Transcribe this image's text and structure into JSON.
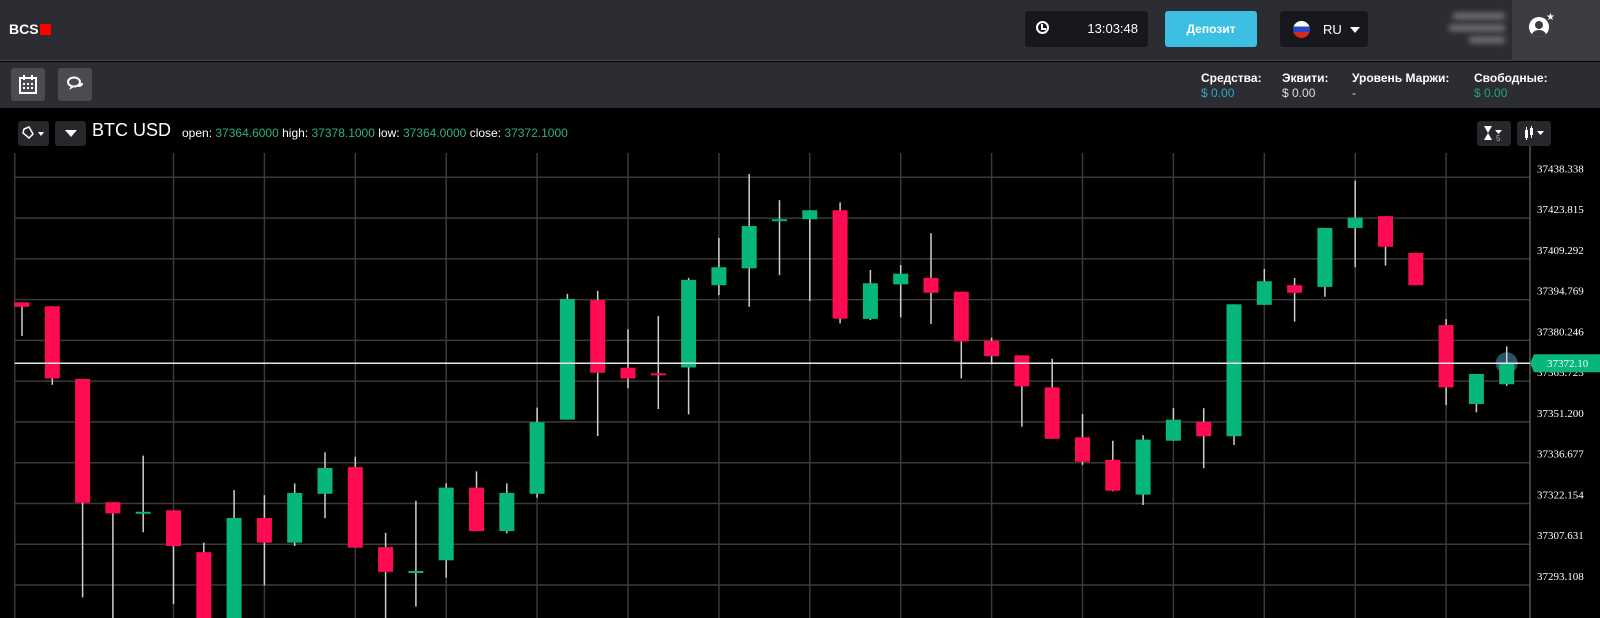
{
  "header": {
    "logo": "BCS",
    "time": "13:03:48",
    "deposit_label": "Депозит",
    "language": "RU"
  },
  "stats": [
    {
      "label": "Средства:",
      "value": "$ 0.00",
      "color": "#2ba8cc"
    },
    {
      "label": "Эквити:",
      "value": "$ 0.00",
      "color": "#dddddd"
    },
    {
      "label": "Уровень Маржи:",
      "value": "-",
      "color": "#dddddd"
    },
    {
      "label": "Свободные:",
      "value": "$ 0.00",
      "color": "#1ea86a"
    }
  ],
  "chart_header": {
    "symbol": "BTC USD",
    "open_label": "open:",
    "open": "37364.6000",
    "high_label": "high:",
    "high": "37378.1000",
    "low_label": "low:",
    "low": "37364.0000",
    "close_label": "close:",
    "close": "37372.1000",
    "interval": "5"
  },
  "colors": {
    "up": "#06b67a",
    "down": "#ff0b52",
    "grid": "#3a3a3a",
    "price_line": "#e6e6e6"
  },
  "chart_data": {
    "type": "candlestick",
    "symbol": "BTC USD",
    "y_ticks": [
      37438.338,
      37423.815,
      37409.292,
      37394.769,
      37380.246,
      37365.723,
      37351.2,
      37336.677,
      37322.154,
      37307.631,
      37293.108
    ],
    "y_tick_labels": [
      "37438.338",
      "37423.815",
      "37409.292",
      "37394.769",
      "37380.246",
      "37365.723",
      "37351.200",
      "37336.677",
      "37322.154",
      "37307.631",
      "37293.108"
    ],
    "current_price": 37372.1,
    "current_price_label": "37372.10",
    "grid": true,
    "candles": [
      [
        37393.8,
        37393.8,
        37381.8,
        37392.2
      ],
      [
        37392.4,
        37392.4,
        37364.4,
        37366.7
      ],
      [
        37366.5,
        37366.5,
        37288.7,
        37322.4
      ],
      [
        37322.6,
        37322.6,
        37277.1,
        37318.6
      ],
      [
        37319.0,
        37339.2,
        37311.9,
        37319.2
      ],
      [
        37319.7,
        37319.7,
        37286.3,
        37307.0
      ],
      [
        37304.8,
        37308.2,
        37269.9,
        37273.5
      ],
      [
        37273.5,
        37326.9,
        37268.0,
        37317.0
      ],
      [
        37317.0,
        37325.1,
        37293.0,
        37308.2
      ],
      [
        37308.2,
        37329.3,
        37307.0,
        37325.9
      ],
      [
        37325.6,
        37340.4,
        37316.9,
        37334.8
      ],
      [
        37335.1,
        37338.8,
        37306.4,
        37306.4
      ],
      [
        37306.6,
        37311.7,
        37273.5,
        37297.8
      ],
      [
        37297.9,
        37323.1,
        37285.4,
        37298.1
      ],
      [
        37301.9,
        37329.3,
        37295.7,
        37327.8
      ],
      [
        37327.8,
        37333.6,
        37312.3,
        37312.3
      ],
      [
        37312.3,
        37329.3,
        37311.5,
        37325.9
      ],
      [
        37325.6,
        37356.3,
        37324.2,
        37351.1
      ],
      [
        37352.0,
        37396.8,
        37352.0,
        37395.0
      ],
      [
        37394.6,
        37397.9,
        37346.2,
        37368.7
      ],
      [
        37370.5,
        37384.2,
        37363.2,
        37366.7
      ],
      [
        37368.5,
        37388.9,
        37355.8,
        37368.3
      ],
      [
        37370.6,
        37402.5,
        37353.9,
        37401.8
      ],
      [
        37399.9,
        37416.7,
        37396.4,
        37406.3
      ],
      [
        37405.9,
        37439.5,
        37392.2,
        37421.0
      ],
      [
        37423.2,
        37430.2,
        37403.5,
        37423.4
      ],
      [
        37423.4,
        37426.6,
        37394.3,
        37426.6
      ],
      [
        37426.6,
        37429.4,
        37386.3,
        37388.0
      ],
      [
        37387.9,
        37405.3,
        37387.5,
        37400.6
      ],
      [
        37400.2,
        37407.1,
        37388.5,
        37404.0
      ],
      [
        37402.5,
        37418.4,
        37386.1,
        37397.2
      ],
      [
        37397.6,
        37397.6,
        37366.7,
        37379.9
      ],
      [
        37380.1,
        37381.2,
        37371.7,
        37374.6
      ],
      [
        37374.9,
        37374.9,
        37349.5,
        37363.9
      ],
      [
        37363.5,
        37373.7,
        37345.2,
        37345.2
      ],
      [
        37345.7,
        37354.0,
        37335.9,
        37337.0
      ],
      [
        37337.7,
        37344.5,
        37326.5,
        37326.7
      ],
      [
        37325.3,
        37346.5,
        37321.6,
        37344.9
      ],
      [
        37344.5,
        37356.1,
        37344.5,
        37352.0
      ],
      [
        37351.2,
        37356.1,
        37334.7,
        37346.1
      ],
      [
        37346.1,
        37393.1,
        37343.0,
        37393.1
      ],
      [
        37392.9,
        37405.7,
        37392.9,
        37401.3
      ],
      [
        37399.9,
        37402.5,
        37386.9,
        37397.2
      ],
      [
        37399.3,
        37420.3,
        37395.8,
        37420.3
      ],
      [
        37420.3,
        37437.1,
        37406.3,
        37424.0
      ],
      [
        37424.5,
        37424.5,
        37406.9,
        37413.6
      ],
      [
        37411.4,
        37411.4,
        37399.9,
        37399.9
      ],
      [
        37385.7,
        37387.8,
        37357.2,
        37363.5
      ],
      [
        37357.6,
        37368.3,
        37354.6,
        37368.3
      ],
      [
        37364.6,
        37378.1,
        37364.0,
        37372.1
      ]
    ],
    "candle_format": [
      "open",
      "high",
      "low",
      "close"
    ]
  }
}
